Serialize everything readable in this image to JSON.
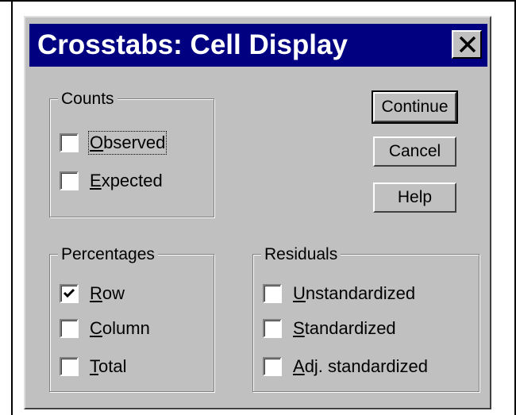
{
  "dialog": {
    "title": "Crosstabs: Cell Display",
    "close_icon": "close-icon"
  },
  "counts": {
    "legend": "Counts",
    "observed": {
      "prefix": "",
      "accel": "O",
      "rest": "bserved",
      "checked": false
    },
    "expected": {
      "prefix": "",
      "accel": "E",
      "rest": "xpected",
      "checked": false
    }
  },
  "percentages": {
    "legend": "Percentages",
    "row": {
      "prefix": "",
      "accel": "R",
      "rest": "ow",
      "checked": true
    },
    "column": {
      "prefix": "",
      "accel": "C",
      "rest": "olumn",
      "checked": false
    },
    "total": {
      "prefix": "",
      "accel": "T",
      "rest": "otal",
      "checked": false
    }
  },
  "residuals": {
    "legend": "Residuals",
    "unstandardized": {
      "prefix": "",
      "accel": "U",
      "rest": "nstandardized",
      "checked": false
    },
    "standardized": {
      "prefix": "",
      "accel": "S",
      "rest": "tandardized",
      "checked": false
    },
    "adj_standardized": {
      "prefix": "",
      "accel": "A",
      "rest": "dj. standardized",
      "checked": false
    }
  },
  "buttons": {
    "continue": "Continue",
    "cancel": "Cancel",
    "help": "Help"
  },
  "colors": {
    "title_bar": "#000080",
    "face": "#c0c0c0"
  }
}
